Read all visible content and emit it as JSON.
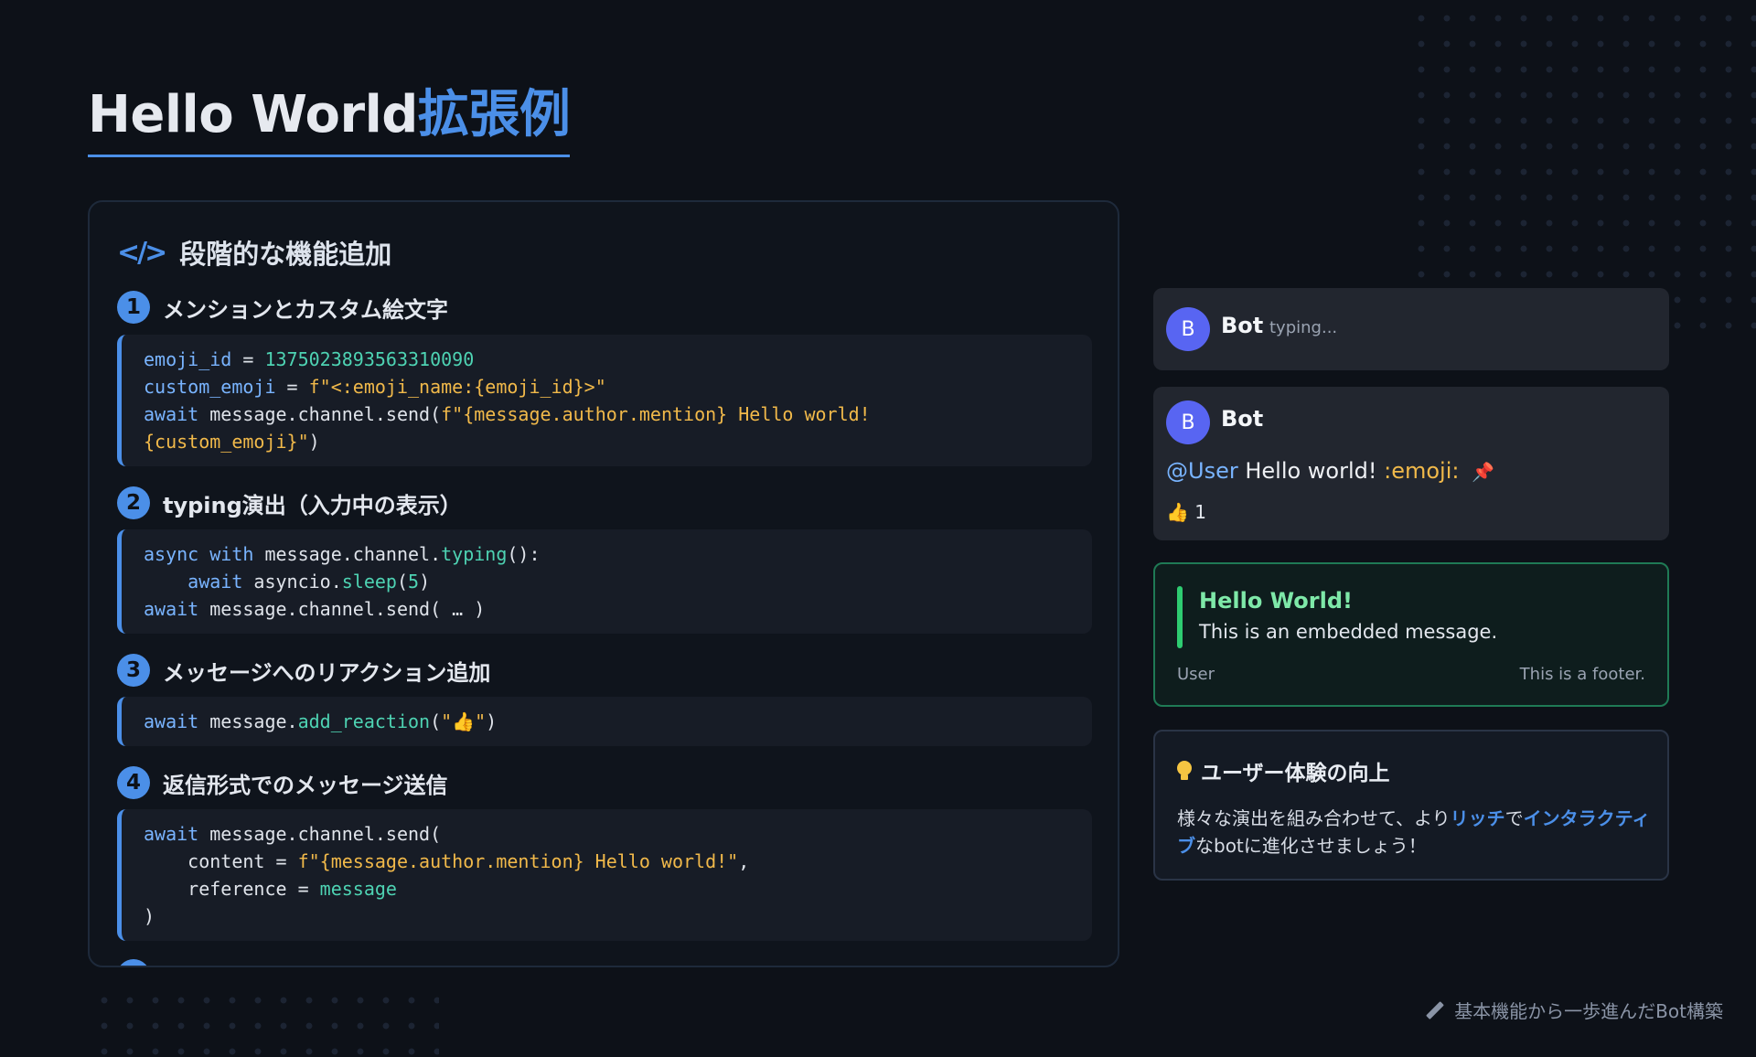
{
  "title": {
    "main": "Hello World",
    "accent": "拡張例"
  },
  "panel": {
    "heading": "段階的な機能追加",
    "steps": [
      {
        "num": "1",
        "title": "メンションとカスタム絵文字"
      },
      {
        "num": "2",
        "title": "typing演出（入力中の表示）"
      },
      {
        "num": "3",
        "title": "メッセージへのリアクション追加"
      },
      {
        "num": "4",
        "title": "返信形式でのメッセージ送信"
      }
    ],
    "code1": {
      "l1_var": "emoji_id",
      "l1_op": " = ",
      "l1_num": "1375023893563310090",
      "l2_var": "custom_emoji",
      "l2_op": " = ",
      "l2_str": "f\"<:emoji_name:{emoji_id}>\"",
      "l3_kw": "await",
      "l3_plain": " message.channel.send(",
      "l3_str": "f\"{message.author.mention} Hello world!",
      "l4_str": "{custom_emoji}\"",
      "l4_plain": ")"
    },
    "code2": {
      "l1_kw1": "async",
      "l1_kw2": "with",
      "l1_plain": " message.channel.",
      "l1_fn": "typing",
      "l1_end": "():",
      "l2_kw": "await",
      "l2_plain": " asyncio.",
      "l2_fn": "sleep",
      "l2_p1": "(",
      "l2_num": "5",
      "l2_p2": ")",
      "l3_kw": "await",
      "l3_plain": " message.channel.send( … )"
    },
    "code3": {
      "l1_kw": "await",
      "l1_plain": " message.",
      "l1_fn": "add_reaction",
      "l1_p1": "(",
      "l1_str": "\"👍\"",
      "l1_p2": ")"
    },
    "code4": {
      "l1_kw": "await",
      "l1_plain": " message.channel.send(",
      "l2_plain": "    content = ",
      "l2_str": "f\"{message.author.mention} Hello world!\"",
      "l2_end": ",",
      "l3_plain": "    reference = ",
      "l3_fn": "message",
      "l4_plain": ")"
    }
  },
  "chat": {
    "typing_box": {
      "avatar": "B",
      "name": "Bot",
      "status": "typing..."
    },
    "message_box": {
      "avatar": "B",
      "name": "Bot",
      "mention": "@User",
      "text": " Hello world! ",
      "emoji": ":emoji:",
      "pin": "📌",
      "reaction_emoji": "👍",
      "reaction_count": "1"
    },
    "embed": {
      "title": "Hello World!",
      "description": "This is an embedded message.",
      "user": "User",
      "footer": "This is a footer."
    }
  },
  "tip": {
    "title": "ユーザー体験の向上",
    "body_1": "様々な演出を組み合わせて、より",
    "hl_1": "リッチ",
    "body_2": "で",
    "hl_2": "インタラクティブ",
    "body_3": "なbotに進化させましょう！"
  },
  "footer": {
    "note": "基本機能から一歩進んだBot構築"
  }
}
